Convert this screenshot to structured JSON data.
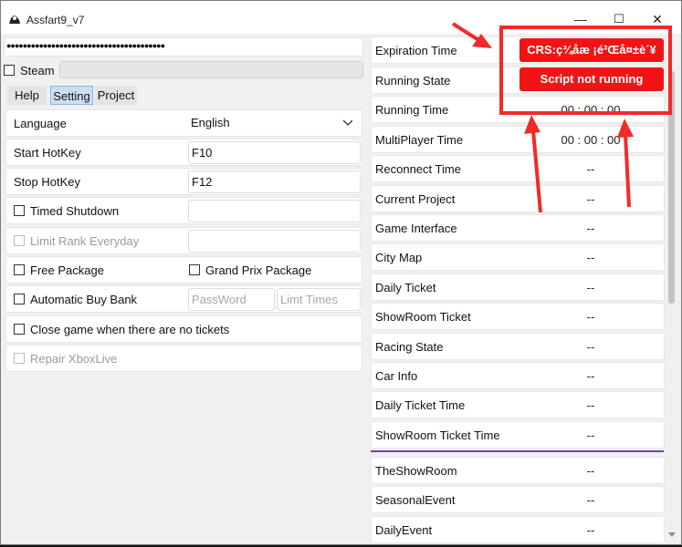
{
  "window": {
    "title": "Assfart9_v7",
    "minimize": "—",
    "maximize": "☐",
    "close": "✕"
  },
  "password": {
    "value": "●●●●●●●●●●●●●●●●●●●●●●●●●●●●●●●●●●●●●●●"
  },
  "steam": {
    "label": "Steam",
    "checked": false
  },
  "tabs": [
    {
      "label": "Help"
    },
    {
      "label": "Setting"
    },
    {
      "label": "Project"
    }
  ],
  "settings": {
    "language": {
      "label": "Language",
      "value": "English"
    },
    "start_hotkey": {
      "label": "Start HotKey",
      "value": "F10"
    },
    "stop_hotkey": {
      "label": "Stop HotKey",
      "value": "F12"
    },
    "timed_shutdown": {
      "label": "Timed Shutdown"
    },
    "limit_rank": {
      "label": "Limit Rank Everyday"
    },
    "free_package": {
      "label": "Free Package"
    },
    "grand_prix_package": {
      "label": "Grand Prix Package"
    },
    "auto_buy_bank": {
      "label": "Automatic Buy Bank",
      "password_placeholder": "PassWord",
      "limit_placeholder": "Limt Times"
    },
    "close_game": {
      "label": "Close game when there are no tickets"
    },
    "repair_xbox": {
      "label": "Repair XboxLive"
    }
  },
  "status_list": [
    {
      "label": "Expiration Time",
      "value": ""
    },
    {
      "label": "Running State",
      "value": ""
    },
    {
      "label": "Running Time",
      "value": "00 : 00 : 00"
    },
    {
      "label": "MultiPlayer Time",
      "value": "00 : 00 : 00"
    },
    {
      "label": "Reconnect Time",
      "value": "--"
    },
    {
      "label": "Current Project",
      "value": "--"
    },
    {
      "label": "Game Interface",
      "value": "--"
    },
    {
      "label": "City Map",
      "value": "--"
    },
    {
      "label": "Daily Ticket",
      "value": "--"
    },
    {
      "label": "ShowRoom Ticket",
      "value": "--"
    },
    {
      "label": "Racing State",
      "value": "--"
    },
    {
      "label": "Car Info",
      "value": "--"
    },
    {
      "label": "Daily Ticket Time",
      "value": "--"
    },
    {
      "label": "ShowRoom Ticket Time",
      "value": "--"
    },
    {
      "label": "TheShowRoom",
      "value": "--"
    },
    {
      "label": "SeasonalEvent",
      "value": "--"
    },
    {
      "label": "DailyEvent",
      "value": "--"
    }
  ],
  "overlay": {
    "crs_button": "CRS:ç¾åæ ¡é³Œå¤±è´¥",
    "script_status": "Script not running"
  },
  "colors": {
    "annotation_red": "#f22a2a",
    "button_red": "#f21414",
    "tab_active": "#cce0f4",
    "divider_purple": "#7b3f9a"
  }
}
